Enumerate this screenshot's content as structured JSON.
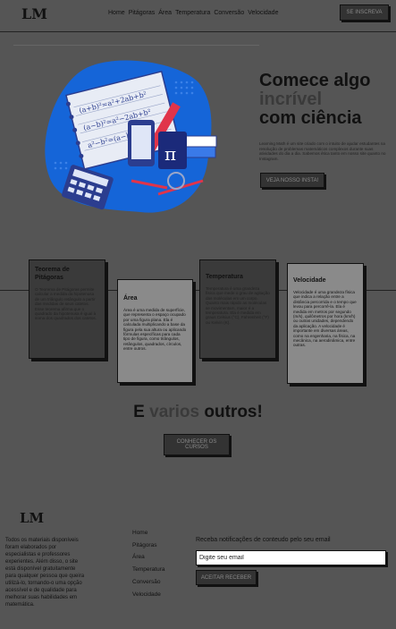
{
  "header": {
    "logo_main": "LM",
    "nav": [
      "Home",
      "Pitágoras",
      "Área",
      "Temperatura",
      "Conversão",
      "Velocidade"
    ],
    "cta_label": "SE INSCREVA"
  },
  "hero": {
    "title_line1": "Comece algo",
    "title_accent": "incrível",
    "title_line3": "com ciência",
    "description": "Learning Math é um site criado com o intuito de ajudar estudantes na resolução de problemas matemáticos complexos durante suas atividades do dia a dia. Sabemos ética tanto em nosso site quanto no Instagram.",
    "cta_label": "VEJA NOSSO INSTA!"
  },
  "cards": [
    {
      "title": "Teorema de Pitágoras",
      "text": "O Teorema de Pitágoras permite calcular a medida da hipotenusa de um triângulo retângulo a partir das medidas de seus catetos. Esse teorema afirma que o quadrado da hipotenusa é igual à soma dos quadrados dos catetos."
    },
    {
      "title": "Área",
      "text": "Área é uma medida de superfície, que representa o espaço ocupado por uma figura plana. Ela é calculada multiplicando a base da figura pela sua altura ou aplicando fórmulas específicas para cada tipo de figura, como triângulos, retângulos, quadrados, círculos, entre outros."
    },
    {
      "title": "Temperatura",
      "text": "Temperatura é uma grandeza física que mede o grau de agitação das moléculas em um corpo. Quanto mais rápido as moléculas se movimentam, maior é a temperatura. Ela é medida em graus Celsius (°C), Fahrenheit (°F) ou Kelvin (K)."
    },
    {
      "title": "Velocidade",
      "text": "Velocidade é uma grandeza física que indica a relação entre a distância percorrida e o tempo que levou para percorrê-la. Ela é medida em metros por segundo (m/s), quilômetros por hora (km/h) ou outras unidades, dependendo da aplicação. A velocidade é importante em diversas áreas, como na engenharia, na física, na mecânica, na aerodinâmica, entre outras."
    }
  ],
  "tagline": {
    "prefix": "E",
    "accent": "varios",
    "suffix": "outros!"
  },
  "more_button": "CONHECER OS CURSOS",
  "footer": {
    "logo_main": "LM",
    "about": "Todos os materiais disponíveis foram elaborados por especialistas e professores experientes. Além disso, o site está disponível gratuitamente para qualquer pessoa que queira utilizá-lo, tornando-o uma opção acessível e de qualidade para melhorar suas habilidades em matemática.",
    "nav": [
      "Home",
      "Pitágoras",
      "Área",
      "Temperatura",
      "Conversão",
      "Velocidade"
    ],
    "newsletter_title": "Receba notificações de conteudo pelo seu email",
    "email_placeholder": "Digite seu email",
    "subscribe_label": "ACEITAR RECEBER"
  }
}
